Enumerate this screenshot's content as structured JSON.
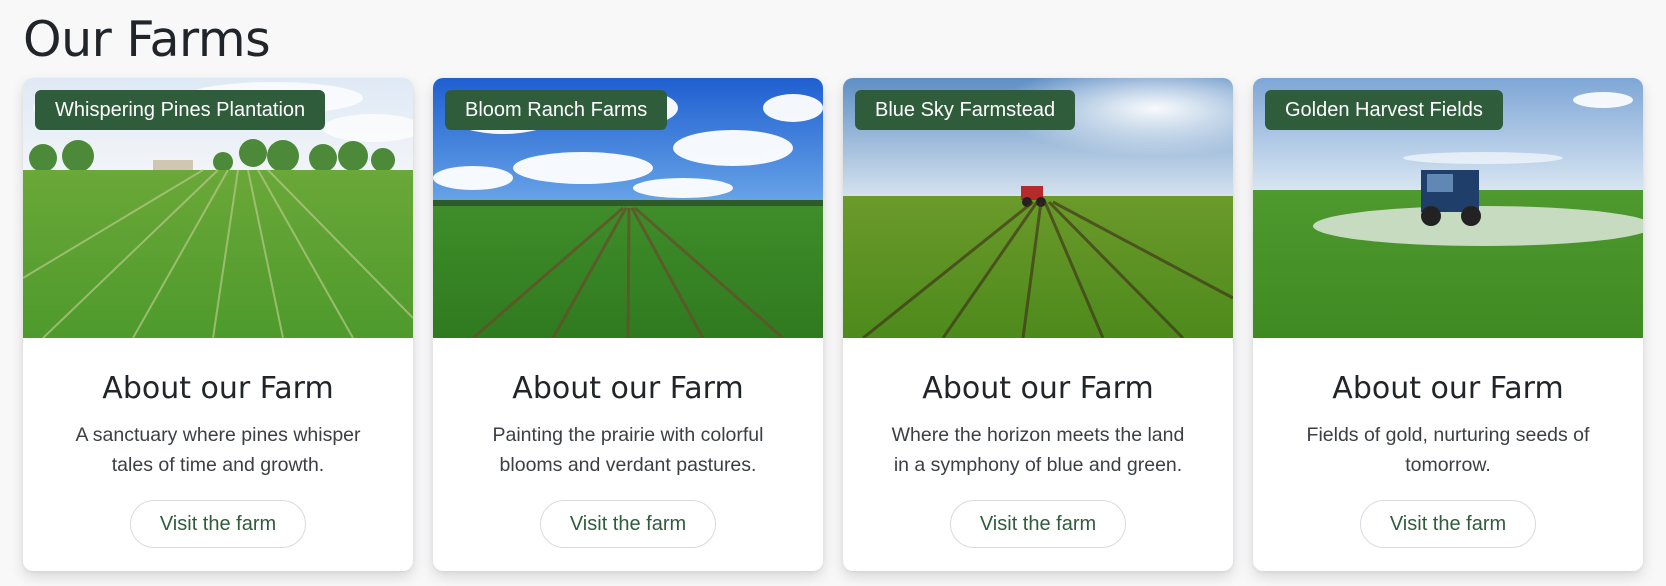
{
  "page": {
    "title": "Our Farms"
  },
  "farms": [
    {
      "name": "Whispering Pines Plantation",
      "heading": "About our Farm",
      "description": "A sanctuary where pines whisper tales of time and growth.",
      "button_label": "Visit the farm"
    },
    {
      "name": "Bloom Ranch Farms",
      "heading": "About our Farm",
      "description": "Painting the prairie with colorful blooms and verdant pastures.",
      "button_label": "Visit the farm"
    },
    {
      "name": "Blue Sky Farmstead",
      "heading": "About our Farm",
      "description": "Where the horizon meets the land in a symphony of blue and green.",
      "button_label": "Visit the farm"
    },
    {
      "name": "Golden Harvest Fields",
      "heading": "About our Farm",
      "description": "Fields of gold, nurturing seeds of tomorrow.",
      "button_label": "Visit the farm"
    }
  ],
  "colors": {
    "badge_background": "#2f5d3c",
    "button_text": "#2f5d3c",
    "page_background": "#f8f8f9"
  }
}
